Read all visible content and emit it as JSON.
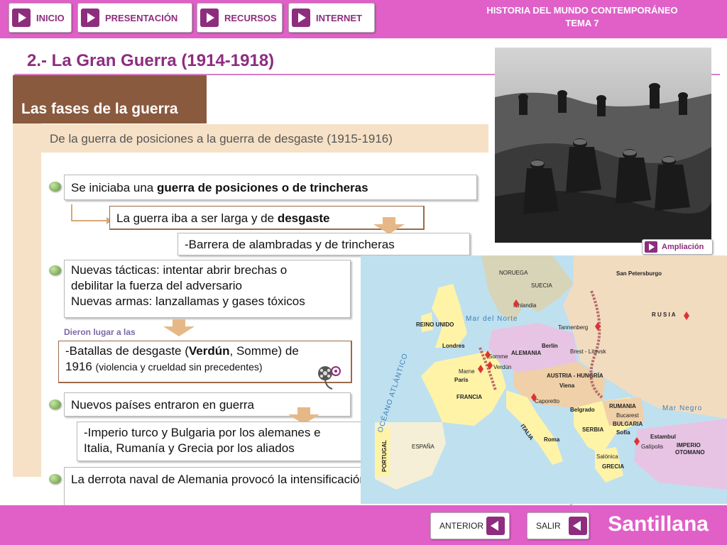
{
  "nav": {
    "items": [
      "INICIO",
      "PRESENTACIÓN",
      "RECURSOS",
      "INTERNET"
    ],
    "course_line1": "HISTORIA DEL MUNDO CONTEMPORÁNEO",
    "course_line2": "TEMA 7"
  },
  "page_title": "2.- La Gran Guerra (1914-1918)",
  "section_title": "Las fases de la guerra",
  "subtitle": "De la guerra de posiciones a la guerra de desgaste (1915-1916)",
  "points": {
    "p1_pre": "Se iniciaba una ",
    "p1_bold": "guerra de posiciones o de trincheras",
    "p1_sub_pre": "La guerra iba a ser larga y de ",
    "p1_sub_bold": "desgaste",
    "p1_sub2": "-Barrera de alambradas y de trincheras",
    "p2_line1": "Nuevas tácticas: intentar abrir brechas o",
    "p2_line2": "debilitar la fuerza del adversario",
    "p2_line3": "Nuevas armas: lanzallamas y gases tóxicos",
    "p2_note": "Dieron lugar a las",
    "p2_sub_pre": "-Batallas de desgaste (",
    "p2_sub_bold": "Verdún",
    "p2_sub_mid": ", Somme) de",
    "p2_sub_year": "1916 ",
    "p2_sub_small": "(violencia y crueldad sin precedentes)",
    "p3": "Nuevos países entraron en guerra",
    "p3_sub1": "-Imperio turco y Bulgaria por los alemanes e",
    "p3_sub2": "Italia, Rumanía y Grecia por los aliados",
    "p4": "La derrota naval de Alemania provocó la intensificación de la guerra submarina"
  },
  "ampliacion_label": "Ampliación",
  "map": {
    "labels": {
      "noruega": "NORUEGA",
      "suecia": "SUECIA",
      "san_petersburgo": "San Petersburgo",
      "finlandia": "Finlandia",
      "rusia": "R U S I A",
      "reino_unido": "REINO UNIDO",
      "mar_del_norte": "Mar del Norte",
      "tannenberg": "Tannenberg",
      "berlin": "Berlín",
      "brest": "Brest - Litovsk",
      "londres": "Londres",
      "somme": "Somme",
      "verdun": "Verdún",
      "alemania": "ALEMANIA",
      "marne": "Marne",
      "paris": "París",
      "austria": "AUSTRIA - HUNGRÍA",
      "viena": "Viena",
      "francia": "FRANCIA",
      "caporetto": "Caporetto",
      "belgrado": "Belgrado",
      "rumania": "RUMANIA",
      "bucarest": "Bucarest",
      "mar_negro": "Mar Negro",
      "italia": "ITALIA",
      "serbia": "SERBIA",
      "sofia": "Sofía",
      "bulgaria": "BULGARIA",
      "estambul": "Estambul",
      "roma": "Roma",
      "imperio_otomano_1": "IMPERIO",
      "imperio_otomano_2": "OTOMANO",
      "portugal": "PORTUGAL",
      "espana": "ESPAÑA",
      "galipolis": "Galípolis",
      "salonica": "Salónica",
      "grecia": "GRECIA",
      "oceano_atlantico": "OCÉANO ATLÁNTICO"
    }
  },
  "bottom": {
    "anterior": "ANTERIOR",
    "salir": "SALIR",
    "brand": "Santillana"
  }
}
